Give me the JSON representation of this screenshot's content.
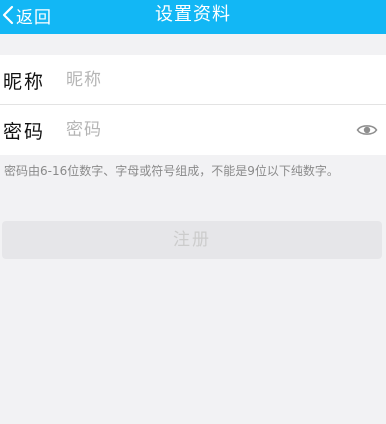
{
  "header": {
    "back_label": "返回",
    "title": "设置资料",
    "back_icon": "chevron-left-icon",
    "background": "#12b7f5"
  },
  "form": {
    "nickname": {
      "label": "昵称",
      "placeholder": "昵称",
      "value": ""
    },
    "password": {
      "label": "密码",
      "placeholder": "密码",
      "value": "",
      "toggle_icon": "eye-icon"
    }
  },
  "hint": "密码由6-16位数字、字母或符号组成，不能是9位以下纯数字。",
  "register_label": "注册",
  "colors": {
    "accent": "#12b7f5",
    "page_background": "#f2f2f4",
    "disabled_button": "#e6e6e9"
  }
}
